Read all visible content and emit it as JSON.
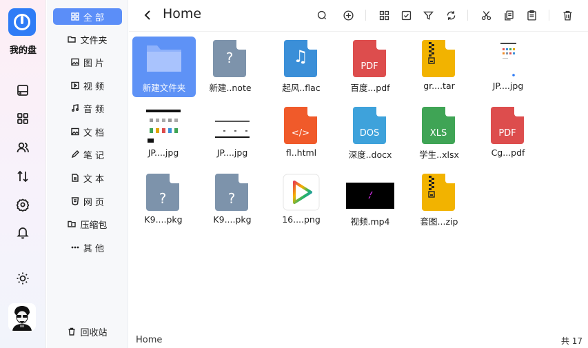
{
  "app": {
    "name": "我的盘"
  },
  "rail": {
    "items": [
      {
        "icon": "drive-icon"
      },
      {
        "icon": "apps-grid-icon"
      },
      {
        "icon": "users-icon"
      },
      {
        "icon": "transfer-icon"
      },
      {
        "icon": "settings-icon"
      },
      {
        "icon": "bell-icon"
      },
      {
        "icon": "sun-icon"
      }
    ]
  },
  "categories": [
    {
      "label": "全 部",
      "icon": "grid-icon"
    },
    {
      "label": "文件夹",
      "icon": "folder-icon"
    },
    {
      "label": "图 片",
      "icon": "image-icon"
    },
    {
      "label": "视 频",
      "icon": "video-icon"
    },
    {
      "label": "音 频",
      "icon": "music-icon"
    },
    {
      "label": "文 档",
      "icon": "document-icon"
    },
    {
      "label": "笔 记",
      "icon": "note-icon"
    },
    {
      "label": "文 本",
      "icon": "text-icon"
    },
    {
      "label": "网 页",
      "icon": "html-icon"
    },
    {
      "label": "压缩包",
      "icon": "archive-icon"
    },
    {
      "label": "其 他",
      "icon": "more-icon"
    }
  ],
  "trash": {
    "label": "回收站",
    "icon": "trash-icon"
  },
  "header": {
    "title": "Home",
    "tools": [
      "search-icon",
      "add-icon",
      "grid-view-icon",
      "checkbox-icon",
      "filter-icon",
      "refresh-icon",
      "cut-icon",
      "copy-icon",
      "paste-icon",
      "delete-icon"
    ]
  },
  "files": [
    {
      "name": "新建文件夹",
      "kind": "folder"
    },
    {
      "name": "新建..note",
      "kind": "doc",
      "color": "#7d93ab",
      "label": "?"
    },
    {
      "name": "起风..flac",
      "kind": "doc",
      "color": "#3b8fd8",
      "label": "♫"
    },
    {
      "name": "百度...pdf",
      "kind": "doc",
      "color": "#dd4d4d",
      "label": "PDF"
    },
    {
      "name": "gr....tar",
      "kind": "zip",
      "color": "#f2b300"
    },
    {
      "name": "JP....jpg",
      "kind": "img-a"
    },
    {
      "name": "JP....jpg",
      "kind": "img-b"
    },
    {
      "name": "JP....jpg",
      "kind": "img-c"
    },
    {
      "name": "fl..html",
      "kind": "doc",
      "color": "#f05a2a",
      "label": "</>"
    },
    {
      "name": "深度..docx",
      "kind": "doc",
      "color": "#3ea2db",
      "label": "DOS"
    },
    {
      "name": "学生..xlsx",
      "kind": "doc",
      "color": "#3fa455",
      "label": "XLS"
    },
    {
      "name": "Cg...pdf",
      "kind": "doc",
      "color": "#dd4d4d",
      "label": "PDF"
    },
    {
      "name": "K9....pkg",
      "kind": "doc",
      "color": "#7d93ab",
      "label": "?"
    },
    {
      "name": "K9....pkg",
      "kind": "doc",
      "color": "#7d93ab",
      "label": "?"
    },
    {
      "name": "16....png",
      "kind": "play"
    },
    {
      "name": "视频.mp4",
      "kind": "video"
    },
    {
      "name": "套图...zip",
      "kind": "zip",
      "color": "#f2b300"
    }
  ],
  "footer": {
    "path": "Home",
    "count": "共 17"
  }
}
